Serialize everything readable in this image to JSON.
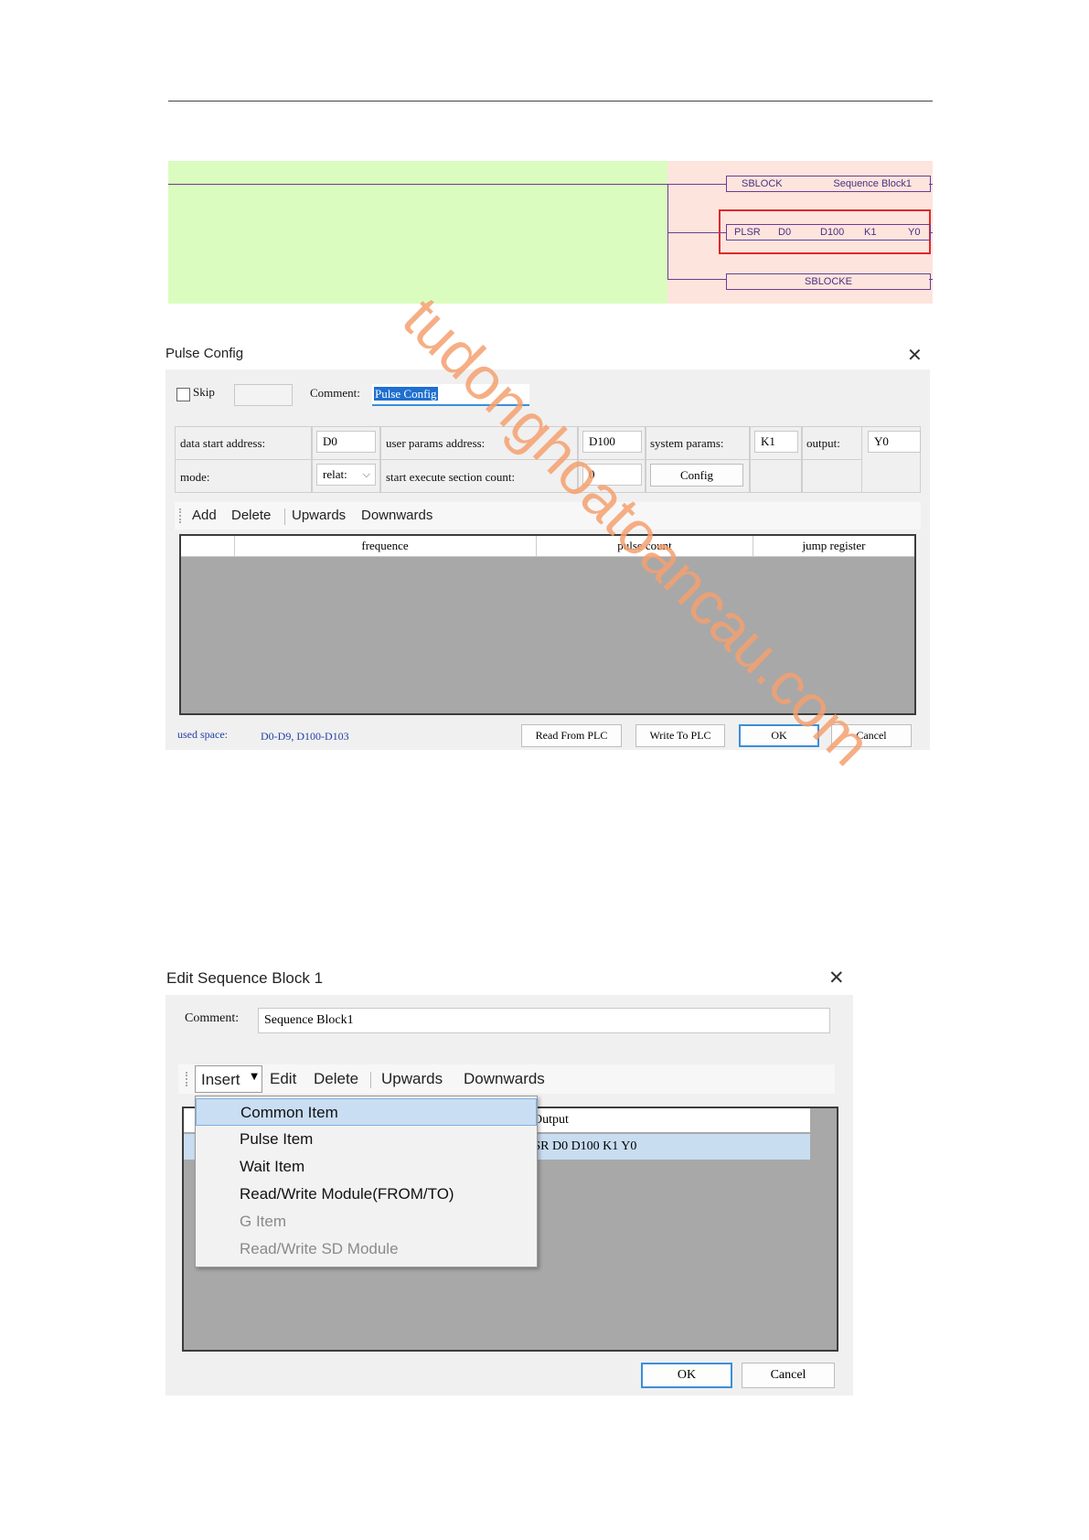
{
  "watermark": "tudonghoatoancau.com",
  "ladder": {
    "row1": {
      "op": "SBLOCK",
      "comment": "Sequence Block1"
    },
    "row2": {
      "op": "PLSR",
      "a": "D0",
      "b": "D100",
      "c": "K1",
      "d": "Y0"
    },
    "row3": {
      "op": "SBLOCKE"
    }
  },
  "pulse_config": {
    "title": "Pulse Config",
    "skip_label": "Skip",
    "comment_label": "Comment:",
    "comment_value": "Pulse Config",
    "data_start_address_label": "data start address:",
    "data_start_address_value": "D0",
    "user_params_address_label": "user params address:",
    "user_params_address_value": "D100",
    "system_params_label": "system params:",
    "system_params_value": "K1",
    "output_label": "output:",
    "output_value": "Y0",
    "mode_label": "mode:",
    "mode_value": "relat:",
    "start_execute_label": "start execute section count:",
    "start_execute_value": "0",
    "config_button": "Config",
    "toolbar": {
      "add": "Add",
      "delete": "Delete",
      "upwards": "Upwards",
      "downwards": "Downwards"
    },
    "columns": [
      "frequence",
      "pulse count",
      "jump register"
    ],
    "used_space_label": "used space:",
    "used_space_value": "D0-D9, D100-D103",
    "buttons": {
      "read": "Read From PLC",
      "write": "Write To PLC",
      "ok": "OK",
      "cancel": "Cancel"
    }
  },
  "edit_sequence": {
    "title": "Edit Sequence Block 1",
    "comment_label": "Comment:",
    "comment_value": "Sequence Block1",
    "toolbar": {
      "insert": "Insert",
      "edit": "Edit",
      "delete": "Delete",
      "upwards": "Upwards",
      "downwards": "Downwards"
    },
    "column_output": "Output",
    "row_output": "PLSR D0 D100 K1 Y0",
    "menu": [
      {
        "label": "Common Item",
        "state": "highlighted"
      },
      {
        "label": "Pulse Item",
        "state": "enabled"
      },
      {
        "label": "Wait Item",
        "state": "enabled"
      },
      {
        "label": "Read/Write Module(FROM/TO)",
        "state": "enabled"
      },
      {
        "label": "G Item",
        "state": "disabled"
      },
      {
        "label": "Read/Write SD Module",
        "state": "disabled"
      }
    ],
    "buttons": {
      "ok": "OK",
      "cancel": "Cancel"
    }
  }
}
